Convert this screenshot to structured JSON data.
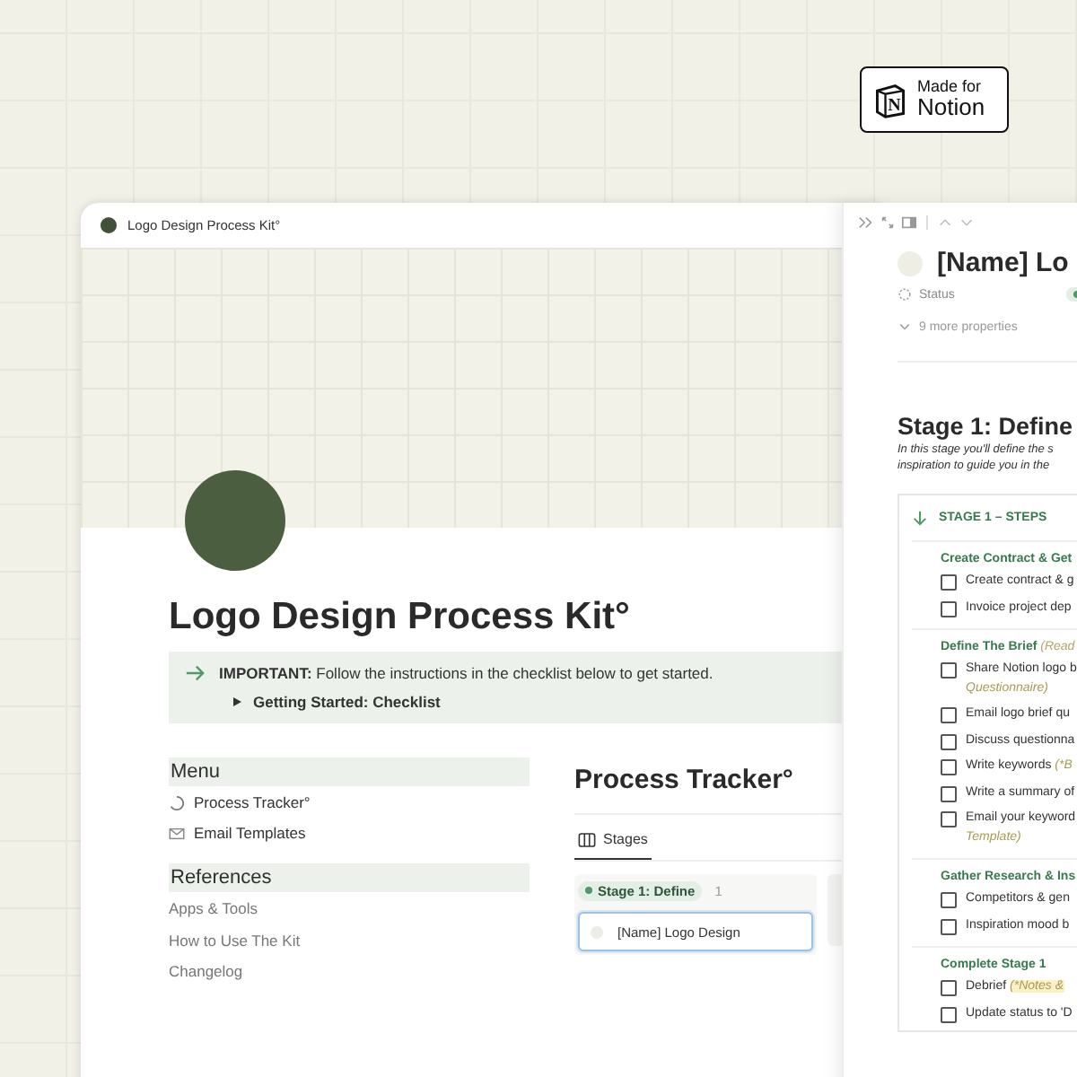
{
  "badge": {
    "logo_letter": "N",
    "line_1": "Made for",
    "line_2": "Notion"
  },
  "window": {
    "title": "Logo Design Process Kit°"
  },
  "page": {
    "title": "Logo Design Process Kit°",
    "callout": {
      "text": "**IMPORTANT:** Follow the instructions in the checklist below to get started.",
      "toggle": "Getting Started: Checklist"
    },
    "menu": {
      "heading": "Menu",
      "items": [
        {
          "label": "Process Tracker°",
          "kind": "database"
        },
        {
          "label": "Email Templates",
          "kind": "page"
        }
      ]
    },
    "references": {
      "heading": "References",
      "items": [
        "Apps & Tools",
        "How to Use The Kit",
        "Changelog"
      ]
    },
    "tracker": {
      "title": "Process Tracker°",
      "tabs": [
        {
          "label": "Stages",
          "selected": true
        }
      ],
      "groups": [
        {
          "label": "Stage 1: Define",
          "count": "1",
          "color": "#4f9a67",
          "cards": [
            {
              "title": "[Name] Logo Design",
              "selected": true
            }
          ]
        }
      ]
    }
  },
  "panel": {
    "title": "[Name] Lo",
    "status_label": "Status",
    "more_properties": "9 more properties",
    "heading": "Stage 1: Define",
    "intro_lines": [
      "In this stage you'll define the s",
      "inspiration to guide you in the"
    ],
    "toggle": "STAGE 1 – STEPS",
    "sections": [
      {
        "title": "Create Contract & Get",
        "items": [
          {
            "text": "Create contract & g",
            "checked": false
          },
          {
            "text": "Invoice project dep",
            "checked": false
          }
        ]
      },
      {
        "title": "Define The Brief",
        "note": "(Read",
        "items": [
          {
            "text": "Share Notion logo b",
            "note": "Questionnaire)",
            "note_below": true,
            "checked": false
          },
          {
            "text": "Email logo brief qu",
            "checked": false
          },
          {
            "text": "Discuss questionna",
            "checked": false
          },
          {
            "text": "Write keywords",
            "note": "(*B",
            "checked": false
          },
          {
            "text": "Write a summary of",
            "checked": false
          },
          {
            "text": "Email your keyword",
            "note": "Template)",
            "note_below": true,
            "checked": false
          }
        ]
      },
      {
        "title": "Gather Research & Ins",
        "items": [
          {
            "text": "Competitors & gen",
            "checked": false
          },
          {
            "text": "Inspiration mood b",
            "checked": false
          }
        ]
      },
      {
        "title": "Complete Stage 1",
        "items": [
          {
            "text": "Debrief",
            "note": "(*Notes &",
            "highlighted": true,
            "checked": false
          },
          {
            "text": "Update status to 'D",
            "checked": false
          }
        ]
      }
    ]
  }
}
